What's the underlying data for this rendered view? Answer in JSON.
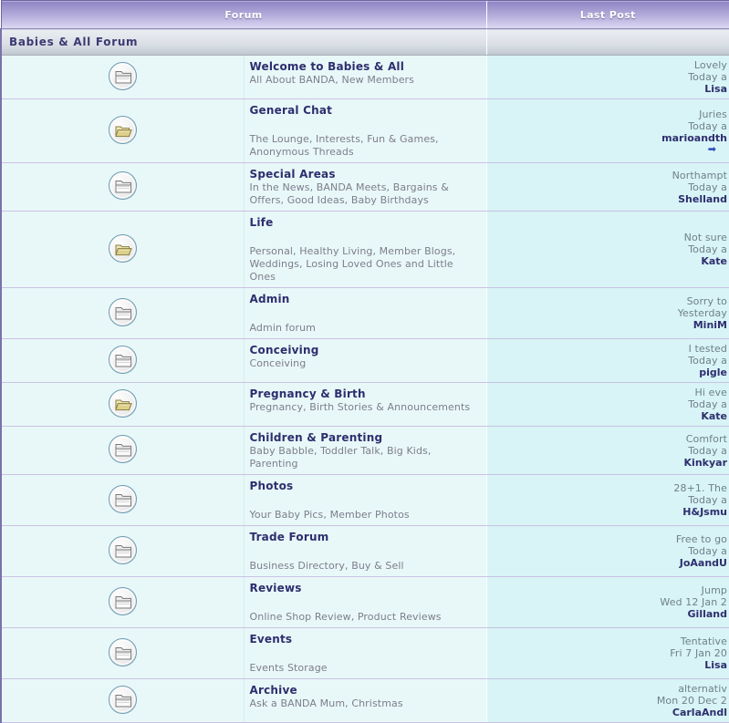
{
  "header": {
    "col_forum": "Forum",
    "col_last_post": "Last Post"
  },
  "category": {
    "title": "Babies & All Forum"
  },
  "icons": {
    "closed_folder": "folder-closed-icon",
    "open_folder": "folder-open-icon",
    "goto_arrow": "goto-last-post-arrow-icon"
  },
  "colors": {
    "header_gradient_top": "#8e83c4",
    "header_gradient_bottom": "#ded9f1",
    "category_bar": "#d8dde4",
    "row_background": "#e8f8f8",
    "lastpost_background": "#d8f4f6",
    "title_text": "#2e2e6e",
    "description_text": "#7d7d8c",
    "row_divider": "#c9c2e4",
    "left_border": "#7b72ab",
    "arrow_blue": "#2a4bbd"
  },
  "forums": [
    {
      "icon": "folder-closed-icon",
      "title": "Welcome to Babies & All",
      "description": "All About BANDA, New Members",
      "desc_spaced": false,
      "last_post": {
        "subject": "Lovely",
        "date": "Today a",
        "user": "Lisa",
        "arrow": false
      }
    },
    {
      "icon": "folder-open-icon",
      "title": "General Chat",
      "description": "The Lounge, Interests, Fun & Games, Anonymous Threads",
      "desc_spaced": true,
      "last_post": {
        "subject": "Juries",
        "date": "Today a",
        "user": "marioandth",
        "arrow": true
      }
    },
    {
      "icon": "folder-closed-icon",
      "title": "Special Areas",
      "description": "In the News, BANDA Meets, Bargains & Offers, Good Ideas, Baby Birthdays",
      "desc_spaced": false,
      "last_post": {
        "subject": "Northampt",
        "date": "Today a",
        "user": "Shelland",
        "arrow": false
      }
    },
    {
      "icon": "folder-open-icon",
      "title": "Life",
      "description": "Personal, Healthy Living, Member Blogs, Weddings, Losing Loved Ones and Little Ones",
      "desc_spaced": true,
      "last_post": {
        "subject": "Not sure",
        "date": "Today a",
        "user": "Kate",
        "arrow": false
      }
    },
    {
      "icon": "folder-closed-icon",
      "title": "Admin",
      "description": "Admin forum",
      "desc_spaced": true,
      "last_post": {
        "subject": "Sorry to",
        "date": "Yesterday",
        "user": "MiniM",
        "arrow": false
      }
    },
    {
      "icon": "folder-closed-icon",
      "title": "Conceiving",
      "description": "Conceiving",
      "desc_spaced": false,
      "last_post": {
        "subject": "I tested",
        "date": "Today a",
        "user": "pigle",
        "arrow": false
      }
    },
    {
      "icon": "folder-open-icon",
      "title": "Pregnancy & Birth",
      "description": "Pregnancy, Birth Stories & Announcements",
      "desc_spaced": false,
      "last_post": {
        "subject": "Hi eve",
        "date": "Today a",
        "user": "Kate",
        "arrow": false
      }
    },
    {
      "icon": "folder-closed-icon",
      "title": "Children & Parenting",
      "description": "Baby Babble, Toddler Talk, Big Kids, Parenting",
      "desc_spaced": false,
      "last_post": {
        "subject": "Comfort",
        "date": "Today a",
        "user": "Kinkyar",
        "arrow": false
      }
    },
    {
      "icon": "folder-closed-icon",
      "title": "Photos",
      "description": "Your Baby Pics, Member Photos",
      "desc_spaced": true,
      "last_post": {
        "subject": "28+1. The",
        "date": "Today a",
        "user": "H&Jsmu",
        "arrow": false
      }
    },
    {
      "icon": "folder-closed-icon",
      "title": "Trade Forum",
      "description": "Business Directory, Buy & Sell",
      "desc_spaced": true,
      "last_post": {
        "subject": "Free to go",
        "date": "Today a",
        "user": "JoAandU",
        "arrow": false
      }
    },
    {
      "icon": "folder-closed-icon",
      "title": "Reviews",
      "description": "Online Shop Review, Product Reviews",
      "desc_spaced": true,
      "last_post": {
        "subject": "Jump",
        "date": "Wed 12 Jan 2",
        "user": "Gilland",
        "arrow": false
      }
    },
    {
      "icon": "folder-closed-icon",
      "title": "Events",
      "description": "Events Storage",
      "desc_spaced": true,
      "last_post": {
        "subject": "Tentative",
        "date": "Fri 7 Jan 20",
        "user": "Lisa",
        "arrow": false
      }
    },
    {
      "icon": "folder-closed-icon",
      "title": "Archive",
      "description": "Ask a BANDA Mum, Christmas",
      "desc_spaced": false,
      "last_post": {
        "subject": "alternativ",
        "date": "Mon 20 Dec 2",
        "user": "CarlaAndl",
        "arrow": false
      }
    }
  ]
}
